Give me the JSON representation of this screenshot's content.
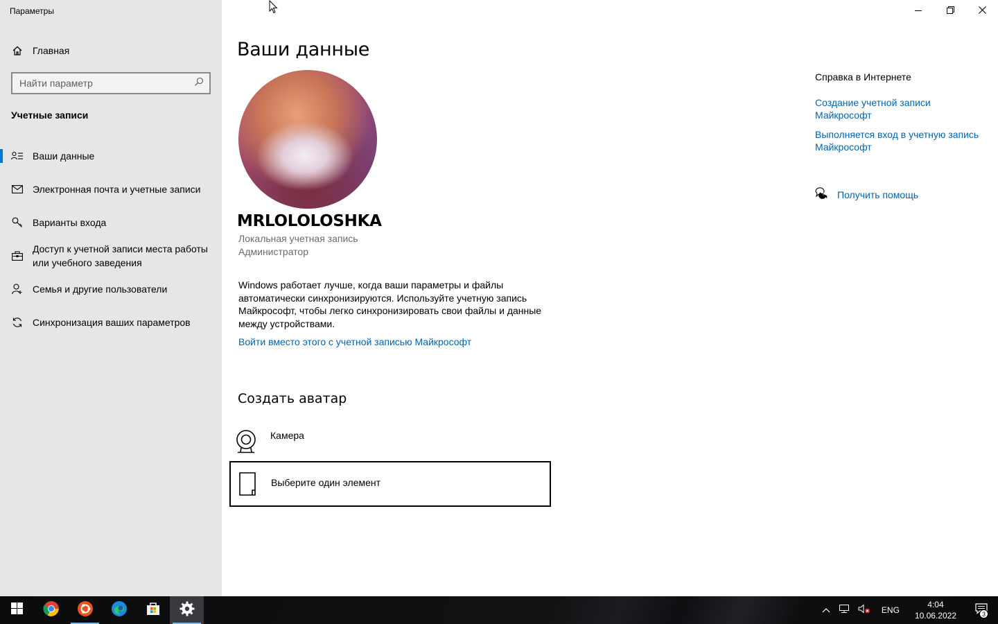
{
  "window": {
    "title": "Параметры"
  },
  "sidebar": {
    "home_label": "Главная",
    "search_placeholder": "Найти параметр",
    "section_title": "Учетные записи",
    "items": [
      {
        "label": "Ваши данные",
        "icon": "person-list-icon",
        "active": true
      },
      {
        "label": "Электронная почта и учетные записи",
        "icon": "mail-icon"
      },
      {
        "label": "Варианты входа",
        "icon": "key-icon"
      },
      {
        "label": "Доступ к учетной записи места работы или учебного заведения",
        "icon": "briefcase-icon"
      },
      {
        "label": "Семья и другие пользователи",
        "icon": "person-add-icon"
      },
      {
        "label": "Синхронизация ваших параметров",
        "icon": "sync-icon"
      }
    ]
  },
  "main": {
    "title": "Ваши данные",
    "username": "MRLOLOLOSHKA",
    "account_type": "Локальная учетная запись",
    "account_role": "Администратор",
    "description": "Windows работает лучше, когда ваши параметры и файлы автоматически синхронизируются. Используйте учетную запись Майкрософт, чтобы легко синхронизировать свои файлы и данные между устройствами.",
    "signin_link": "Войти вместо этого с учетной записью Майкрософт",
    "avatar_section_title": "Создать аватар",
    "camera_label": "Камера",
    "browse_label": "Выберите один элемент"
  },
  "right_panel": {
    "title": "Справка в Интернете",
    "links": [
      "Создание учетной записи Майкрософт",
      "Выполняется вход в учетную запись Майкрософт"
    ],
    "get_help": "Получить помощь"
  },
  "taskbar": {
    "apps": [
      "start",
      "chrome",
      "ubuntu",
      "edge",
      "store",
      "settings"
    ],
    "language": "ENG",
    "time": "4:04",
    "date": "10.06.2022",
    "notification_count": "3"
  },
  "colors": {
    "accent": "#0078d7",
    "link": "#0063b1",
    "sidebar_bg": "#e6e6e6"
  }
}
